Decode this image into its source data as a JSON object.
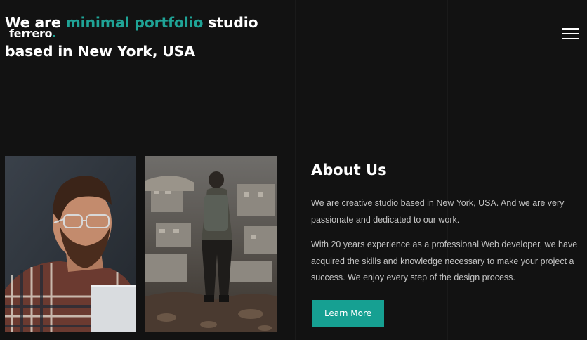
{
  "hero": {
    "title_before": "We are ",
    "title_accent": "minimal portfolio",
    "title_after": " studio",
    "title_line2": "based in New York, USA"
  },
  "logo": {
    "text": "ferrero",
    "dot": "."
  },
  "colors": {
    "background": "#121212",
    "accent": "#1fa396",
    "button": "#16a092",
    "text_muted": "#c4c4c4"
  },
  "menu": {
    "icon": "hamburger-menu-icon"
  },
  "gallery": [
    {
      "subject": "bearded man with glasses looking at laptop"
    },
    {
      "subject": "backpacker standing on hill overlooking town"
    }
  ],
  "about": {
    "heading": "About Us",
    "paragraph1": "We are creative studio based in New York, USA. And we are very passionate and dedicated to our work.",
    "paragraph2": "With 20 years experience as a professional Web developer, we have acquired the skills and knowledge necessary to make your project a success. We enjoy every step of the design process.",
    "button_label": "Learn More"
  }
}
